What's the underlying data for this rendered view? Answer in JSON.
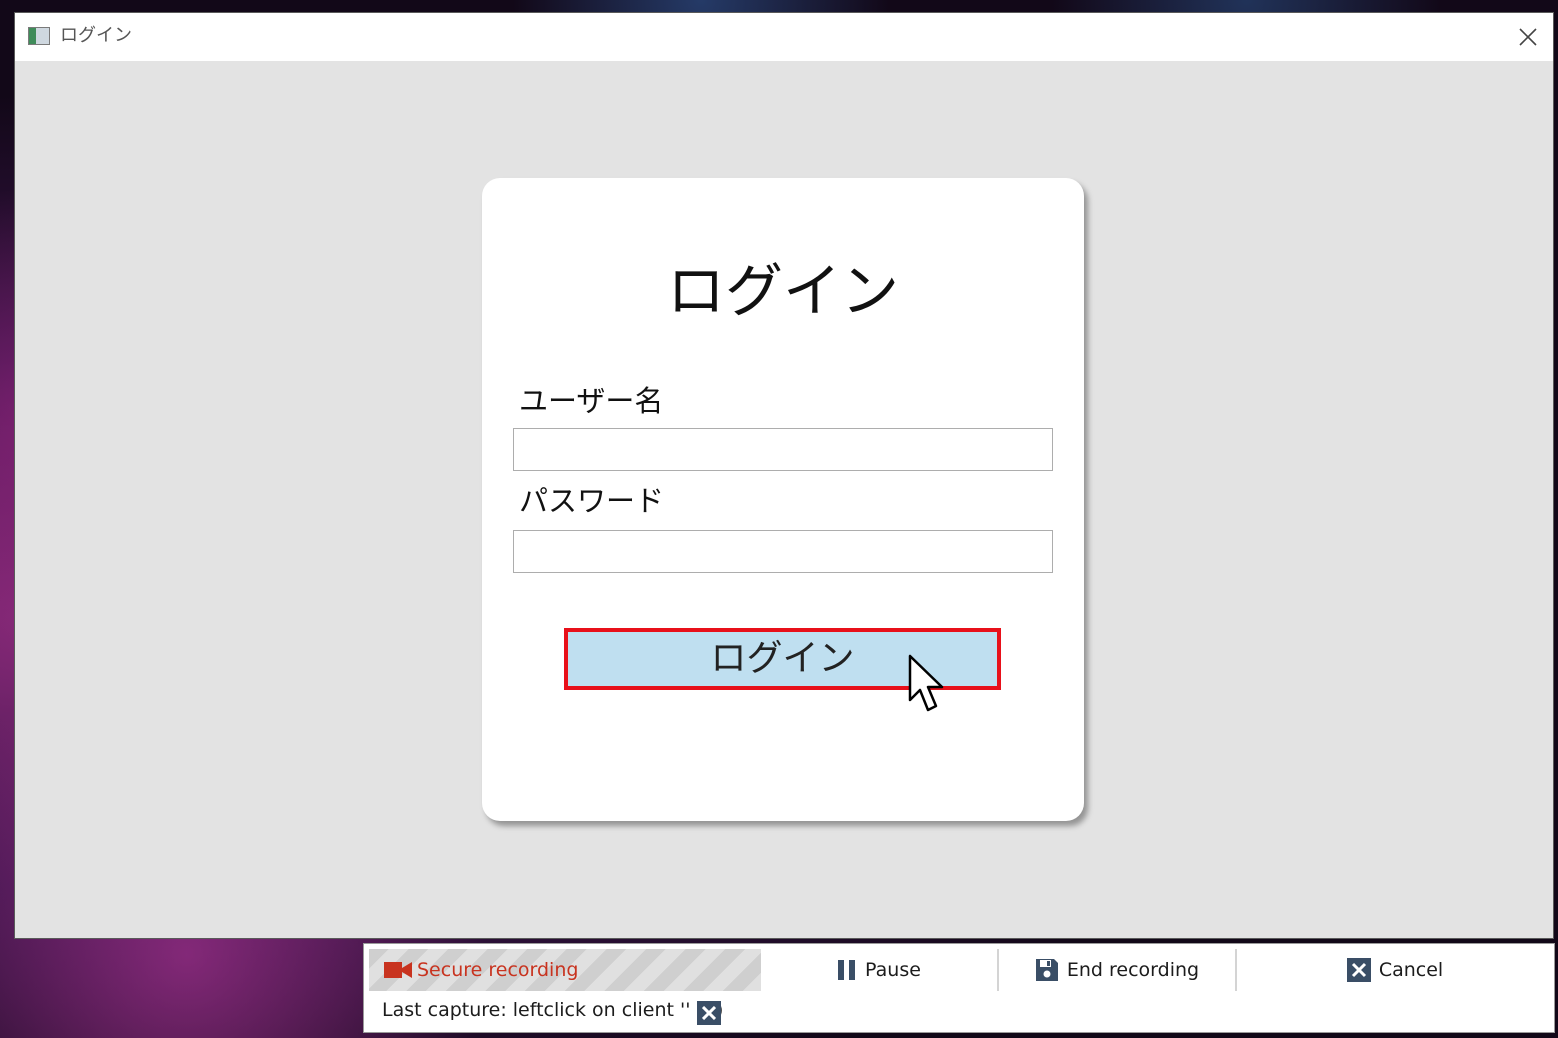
{
  "window": {
    "title": "ログイン"
  },
  "login_form": {
    "heading": "ログイン",
    "username_label": "ユーザー名",
    "username_value": "",
    "password_label": "パスワード",
    "password_value": "",
    "login_button_label": "ログイン"
  },
  "recording_toolbar": {
    "status_label": "Secure recording",
    "pause_label": "Pause",
    "end_label": "End recording",
    "cancel_label": "Cancel",
    "last_capture": "Last capture: leftclick on client '' (1)"
  },
  "icons": {
    "app": "app-window-icon",
    "close": "close-icon",
    "recording": "video-camera-icon",
    "pause": "pause-icon",
    "end": "save-icon",
    "cancel": "cancel-x-icon",
    "dismiss": "dismiss-x-icon",
    "cursor": "mouse-cursor-icon"
  },
  "colors": {
    "window_bg": "#e3e3e3",
    "login_button_bg": "#bfdff0",
    "highlight_border": "#e8101a",
    "recording_red": "#c8331f",
    "toolbar_icon": "#3a4e66"
  }
}
